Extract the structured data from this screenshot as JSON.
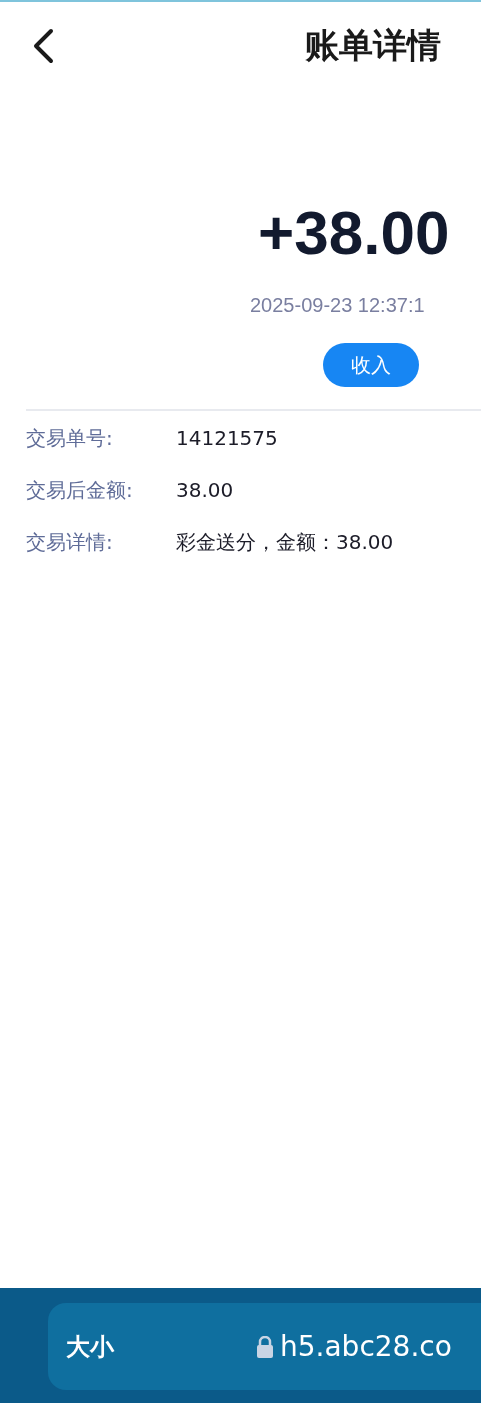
{
  "header": {
    "title": "账单详情"
  },
  "amount": "+38.00",
  "time": "2025-09-23 12:37:1",
  "badge": "收入",
  "details": [
    {
      "label": "交易单号:",
      "value": "14121575"
    },
    {
      "label": "交易后金额:",
      "value": "38.00"
    },
    {
      "label": "交易详情:",
      "value": "彩金送分，金额：38.00"
    }
  ],
  "browser_bar": {
    "text_size": "大小",
    "url": "h5.abc28.co"
  }
}
